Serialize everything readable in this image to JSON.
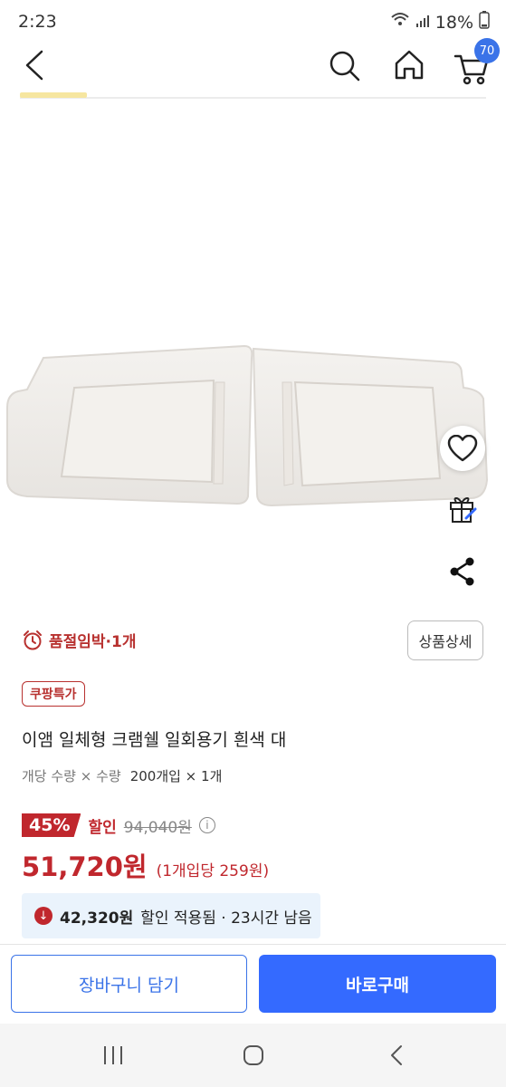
{
  "status_bar": {
    "time": "2:23",
    "battery": "18%"
  },
  "nav": {
    "cart_count": "70"
  },
  "product": {
    "stock_notice": "품절임박·1개",
    "detail_button": "상품상세",
    "promo_badge": "쿠팡특가",
    "title": "이앰 일체형 크램쉘 일회용기 흰색 대",
    "option_label": "개당 수량 × 수량",
    "option_value": "200개입 × 1개",
    "discount_rate": "45%",
    "discount_word": "할인",
    "original_price": "94,040원",
    "price": "51,720원",
    "unit_price": "(1개입당 259원)",
    "coupon_amount": "42,320원",
    "coupon_text": "할인 적용됨 · 23시간 남음"
  },
  "actions": {
    "cart_label": "장바구니 담기",
    "buy_label": "바로구매"
  },
  "colors": {
    "accent": "#346aff",
    "sale_red": "#c0272d",
    "coupon_bg": "#eaf3fc"
  },
  "icons": [
    "back-icon",
    "search-icon",
    "home-icon",
    "cart-icon",
    "heart-icon",
    "gift-icon",
    "share-icon",
    "alarm-clock-icon",
    "info-icon",
    "down-arrow-icon",
    "recent-apps-icon",
    "home-circle-icon",
    "back-nav-icon"
  ]
}
